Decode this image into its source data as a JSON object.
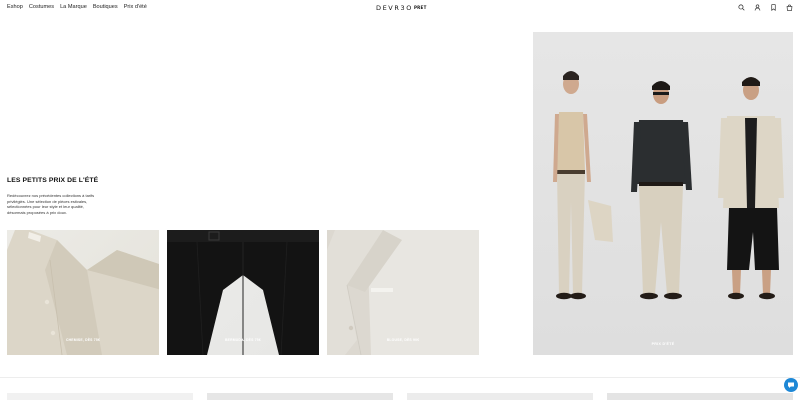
{
  "nav": {
    "items": [
      "Eshop",
      "Costumes",
      "La Marque",
      "Boutiques",
      "Prix d'été"
    ]
  },
  "logo": {
    "text": "DEVR3O",
    "sub": "PRET"
  },
  "header_icons": [
    "search-icon",
    "account-icon",
    "bookmark-icon",
    "bag-icon"
  ],
  "intro": {
    "title": "LES PETITS PRIX DE L'ÉTÉ",
    "body": "Redécouvrez nos précédentes collections à tarifs privilégiés. Une sélection de pièces estivales, sélectionnées pour leur style et leur qualité, désormais proposées à prix doux."
  },
  "cards": [
    {
      "label": "CHEMISE, DÈS 75€"
    },
    {
      "label": "BERMUDA, DÈS 75€"
    },
    {
      "label": "BLOUSE, DÈS 90€"
    }
  ],
  "hero": {
    "label": "PRIX D'ÉTÉ"
  },
  "colors": {
    "chat": "#1e88d6",
    "text": "#111111",
    "hero_bg": "#e3e3e3"
  }
}
